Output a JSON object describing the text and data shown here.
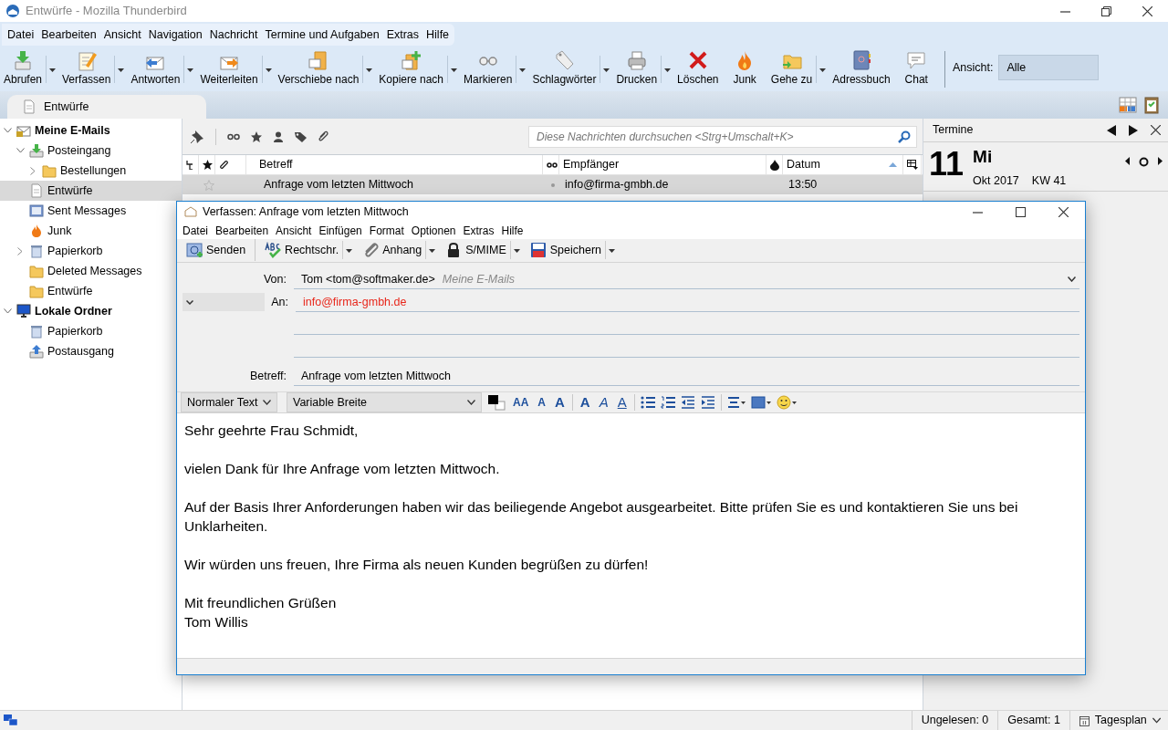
{
  "window": {
    "title": "Entwürfe - Mozilla Thunderbird"
  },
  "menu": [
    "Datei",
    "Bearbeiten",
    "Ansicht",
    "Navigation",
    "Nachricht",
    "Termine und Aufgaben",
    "Extras",
    "Hilfe"
  ],
  "toolbar": [
    {
      "label": "Abrufen",
      "dropdown": true
    },
    {
      "label": "Verfassen",
      "dropdown": true
    },
    {
      "label": "Antworten",
      "dropdown": true
    },
    {
      "label": "Weiterleiten",
      "dropdown": true
    },
    {
      "label": "Verschiebe nach",
      "dropdown": true
    },
    {
      "label": "Kopiere nach",
      "dropdown": true
    },
    {
      "label": "Markieren",
      "dropdown": true
    },
    {
      "label": "Schlagwörter",
      "dropdown": true
    },
    {
      "label": "Drucken",
      "dropdown": true
    },
    {
      "label": "Löschen",
      "dropdown": false
    },
    {
      "label": "Junk",
      "dropdown": false
    },
    {
      "label": "Gehe zu",
      "dropdown": true
    },
    {
      "label": "Adressbuch",
      "dropdown": false
    },
    {
      "label": "Chat",
      "dropdown": false
    }
  ],
  "view_filter": {
    "label": "Ansicht:",
    "value": "Alle"
  },
  "tabs": [
    {
      "label": "Entwürfe",
      "selected": true
    }
  ],
  "folders": [
    {
      "name": "Meine E-Mails",
      "kind": "account",
      "expanded": true,
      "selected": false,
      "children": [
        {
          "name": "Posteingang",
          "kind": "inbox",
          "expanded": true,
          "selected": false,
          "children": [
            {
              "name": "Bestellungen",
              "kind": "folder",
              "expanded": false,
              "selected": false
            }
          ]
        },
        {
          "name": "Entwürfe",
          "kind": "drafts",
          "selected": true
        },
        {
          "name": "Sent Messages",
          "kind": "sent",
          "selected": false
        },
        {
          "name": "Junk",
          "kind": "junk",
          "selected": false
        },
        {
          "name": "Papierkorb",
          "kind": "trash",
          "expanded": false,
          "selected": false
        },
        {
          "name": "Deleted Messages",
          "kind": "folder",
          "selected": false
        },
        {
          "name": "Entwürfe",
          "kind": "folder",
          "selected": false
        }
      ]
    },
    {
      "name": "Lokale Ordner",
      "kind": "local",
      "expanded": true,
      "selected": false,
      "children": [
        {
          "name": "Papierkorb",
          "kind": "trash",
          "selected": false
        },
        {
          "name": "Postausgang",
          "kind": "outbox",
          "selected": false
        }
      ]
    }
  ],
  "search": {
    "placeholder": "Diese Nachrichten durchsuchen <Strg+Umschalt+K>"
  },
  "message_list": {
    "columns": [
      {
        "label": "Betreff",
        "sorted": false
      },
      {
        "label": "Empfänger",
        "sorted": false
      },
      {
        "label": "Datum",
        "sorted": true
      }
    ],
    "rows": [
      {
        "subject": "Anfrage vom letzten Mittwoch",
        "recipient": "info@firma-gmbh.de",
        "date": "13:50",
        "starred": false,
        "selected": true
      }
    ]
  },
  "calendar": {
    "title": "Termine",
    "day": "11",
    "weekday": "Mi",
    "month": "Okt 2017",
    "week": "KW 41"
  },
  "compose": {
    "title": "Verfassen: Anfrage vom letzten Mittwoch",
    "menu": [
      "Datei",
      "Bearbeiten",
      "Ansicht",
      "Einfügen",
      "Format",
      "Optionen",
      "Extras",
      "Hilfe"
    ],
    "toolbar": [
      {
        "label": "Senden",
        "dropdown": false
      },
      {
        "label": "Rechtschr.",
        "dropdown": true
      },
      {
        "label": "Anhang",
        "dropdown": true
      },
      {
        "label": "S/MIME",
        "dropdown": true
      },
      {
        "label": "Speichern",
        "dropdown": true
      }
    ],
    "from": {
      "label": "Von:",
      "value": "Tom <tom@softmaker.de>",
      "account": "Meine E-Mails"
    },
    "to": {
      "label": "An:",
      "value": "info@firma-gmbh.de"
    },
    "subject": {
      "label": "Betreff:",
      "value": "Anfrage vom letzten Mittwoch"
    },
    "paragraph_format": "Normaler Text",
    "font": "Variable Breite",
    "text_buttons": [
      {
        "kind": "size",
        "label": "AA"
      },
      {
        "kind": "smaller",
        "label": "A"
      },
      {
        "kind": "larger",
        "label": "A"
      },
      {
        "kind": "bold",
        "label": "A"
      },
      {
        "kind": "italic",
        "label": "A"
      },
      {
        "kind": "underline",
        "label": "A"
      }
    ],
    "body": [
      [
        "Sehr geehrte Frau Schmidt,"
      ],
      [
        "vielen Dank für Ihre Anfrage vom letzten Mittwoch."
      ],
      [
        "Auf der Basis Ihrer Anforderungen haben wir das beiliegende Angebot ausgearbeitet. Bitte prüfen Sie es und kontaktieren Sie uns bei Unklarheiten."
      ],
      [
        "Wir würden uns freuen, Ihre Firma als neuen Kunden begrüßen zu dürfen!"
      ],
      [
        "Mit freundlichen Grüßen",
        "Tom Willis"
      ]
    ]
  },
  "status_bar": {
    "unread": "Ungelesen: 0",
    "total": "Gesamt: 1",
    "today_pane": "Tagesplan"
  }
}
